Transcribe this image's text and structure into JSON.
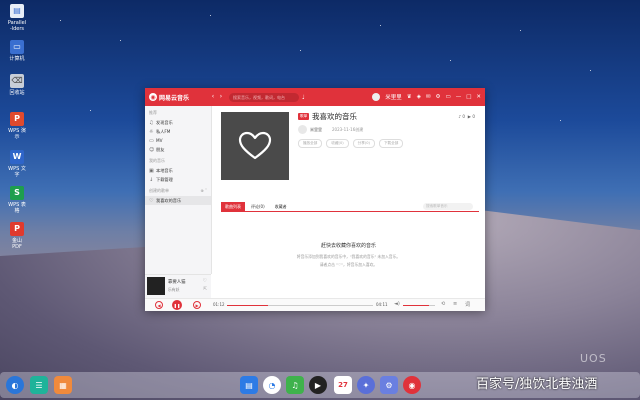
{
  "desktop": {
    "icons": [
      {
        "label": "Parallels Folders",
        "line1": "Parallel",
        "line2": "-lders",
        "color": "#e8eef7"
      },
      {
        "label": "计算机",
        "color": "#3a6fd0"
      },
      {
        "label": "回收站",
        "color": "#c8ced8"
      },
      {
        "label": "WPS 演示",
        "line1": "WPS 演",
        "line2": "示",
        "color": "#e04a2e"
      },
      {
        "label": "WPS 文字",
        "line1": "WPS 文",
        "line2": "字",
        "color": "#2f65c9"
      },
      {
        "label": "WPS 表格",
        "line1": "WPS 表",
        "line2": "格",
        "color": "#1e9e4d"
      },
      {
        "label": "金山 PDF",
        "line1": "金山",
        "line2": "PDF",
        "color": "#e03a2e"
      }
    ],
    "watermark_logo": "UOS",
    "watermark_text": "百家号/独饮北巷浊酒"
  },
  "app": {
    "name": "网易云音乐",
    "search_placeholder": "搜索音乐，视频，歌词，电台",
    "username": "米里里",
    "accent": "#e0323b"
  },
  "sidebar": {
    "section_recommend": "推荐",
    "items_recommend": [
      {
        "icon": "♫",
        "label": "发现音乐"
      },
      {
        "icon": "☼",
        "label": "私人FM"
      },
      {
        "icon": "▭",
        "label": "MV"
      },
      {
        "icon": "☺",
        "label": "朋友"
      }
    ],
    "section_my": "我的音乐",
    "items_my": [
      {
        "icon": "▣",
        "label": "本地音乐"
      },
      {
        "icon": "↓",
        "label": "下载管理"
      }
    ],
    "section_created": "创建的歌单",
    "items_created": [
      {
        "icon": "♡",
        "label": "我喜欢的音乐"
      }
    ]
  },
  "now_playing": {
    "title": "靠要人猫",
    "artist": "乐有妖"
  },
  "playlist": {
    "tag": "歌单",
    "title": "我喜欢的音乐",
    "tracks_icon": "♪",
    "tracks_count": "0",
    "plays_count": "0",
    "user": "米里里",
    "date": "2023-11-16创建",
    "actions": [
      "播放全部",
      "收藏(0)",
      "分享(0)",
      "下载全部"
    ],
    "tabs": [
      "歌曲列表",
      "评论(0)",
      "收藏者"
    ],
    "search_placeholder": "搜索歌单音乐",
    "empty_title": "赶快去收藏你喜欢的音乐",
    "empty_line1": "将音乐添加到我喜欢的音乐中，\"我喜欢的音乐\" 未加入音乐。",
    "empty_line2": "请者点击 \"♡\"，将音乐加入喜欢。"
  },
  "player": {
    "time_current": "01:12",
    "time_total": "04:11",
    "progress": 0.28,
    "volume": 0.8
  }
}
